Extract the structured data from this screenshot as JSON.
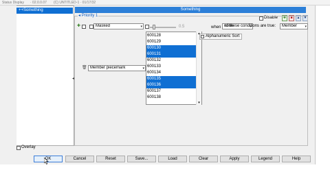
{
  "titlebar": {
    "left_text": "Status Display",
    "mid_text": "· 02.0.0.07",
    "right_text": "(C) UNTITLED-1 · 01/17/32"
  },
  "tree": {
    "items": [
      {
        "label": "+Something",
        "expander": "+"
      }
    ]
  },
  "rule": {
    "header_title": "Something",
    "disable_label": "Disable",
    "icons": [
      "add-icon",
      "red-icon",
      "move-up-icon",
      "filter-icon"
    ],
    "priority_label": "Priority 1"
  },
  "condition1": {
    "property_value": "Masked",
    "slider_value": "0.5",
    "when_label": "when",
    "when_value": "none",
    "conditions_text": "of these conditions are true:",
    "target_value": "Member"
  },
  "condition2": {
    "property_value": "Member piecemark"
  },
  "value_list": {
    "items": [
      "600128",
      "600129",
      "600130",
      "600131",
      "600132",
      "600133",
      "600134",
      "600135",
      "600136",
      "600137",
      "600138"
    ],
    "selected": [
      2,
      3,
      7,
      8
    ]
  },
  "sort_button_label": "Alphanumeric Sort",
  "overlay_label": "Overlay",
  "buttons": {
    "ok": "OK",
    "cancel": "Cancel",
    "reset": "Reset",
    "save": "Save...",
    "load": "Load",
    "clear": "Clear",
    "apply": "Apply",
    "legend": "Legend",
    "help": "Help"
  },
  "colors": {
    "selection": "#0f6fd3",
    "header": "#2c7fd8",
    "dialog_bg": "#f0f0f0"
  }
}
